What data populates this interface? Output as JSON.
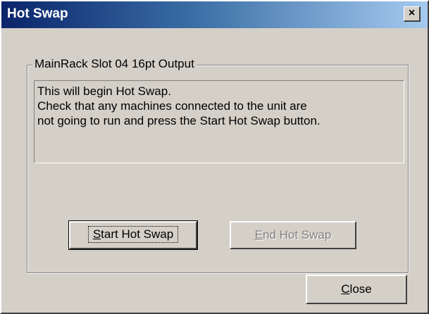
{
  "window": {
    "title": "Hot Swap",
    "close_glyph": "×"
  },
  "group": {
    "label": "MainRack Slot 04 16pt Output"
  },
  "message": {
    "lines": [
      "This will begin Hot Swap.",
      "Check that any machines connected to the unit are",
      "not going to run and press the Start Hot Swap button."
    ]
  },
  "buttons": {
    "start": {
      "mnemonic": "S",
      "rest": "tart Hot Swap",
      "enabled": true,
      "focused": true
    },
    "end": {
      "mnemonic": "E",
      "rest": "nd Hot Swap",
      "enabled": false
    },
    "close": {
      "mnemonic": "C",
      "rest": "lose",
      "enabled": true
    }
  },
  "colors": {
    "titlebar_start": "#0a246a",
    "titlebar_end": "#a6caf0",
    "face": "#d4d0c8",
    "disabled_text": "#808080"
  }
}
